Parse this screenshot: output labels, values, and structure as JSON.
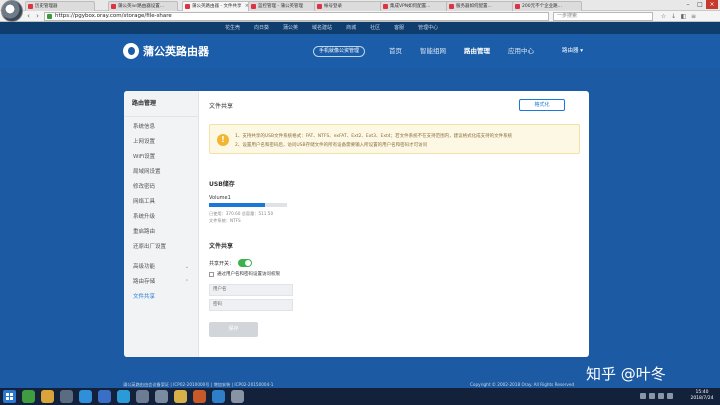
{
  "browser": {
    "tabs": [
      {
        "label": "历史管理器"
      },
      {
        "label": "蒲公英ivr路由器设置..."
      },
      {
        "label": "蒲公英路由器 - 文件共享"
      },
      {
        "label": "蓝控管理 - 蒲公英管理"
      },
      {
        "label": "帐号登录"
      },
      {
        "label": "集成VPN如何配置..."
      },
      {
        "label": "服务器如何配置..."
      },
      {
        "label": "200元不个企业路..."
      }
    ],
    "url": "https://pgybox.oray.com/storage/file-share",
    "search_placeholder": "一步搜索"
  },
  "site_topstrip": {
    "links": [
      "花生壳",
      "向日葵",
      "蒲公英",
      "域名建站",
      "商城",
      "社区",
      "客服",
      "管理中心"
    ]
  },
  "header": {
    "brand": "蒲公英路由器",
    "mobile_button": "手机就像公资管理",
    "nav": [
      "首页",
      "智能组网",
      "路由管理",
      "应用中心"
    ],
    "active_nav": "路由管理",
    "router_dropdown": "路由器 ▾"
  },
  "sidebar": {
    "title": "路由管理",
    "items": [
      "系统信息",
      "上网设置",
      "WiFi设置",
      "局域网设置",
      "修改密码",
      "网络工具",
      "系统升级",
      "重启路由",
      "还原出厂设置"
    ],
    "groups": [
      {
        "label": "高级功能",
        "chev": "⌄"
      },
      {
        "label": "路由存储",
        "chev": "⌃"
      }
    ],
    "active_item": "文件共享"
  },
  "main": {
    "title": "文件共享",
    "format_button": "格式化",
    "notice": {
      "line1": "1、支持共享的USB文件系统格式：FAT、NTFS、exFAT、Ext2、Ext3、Ext4；若文件系统不在支持范围内，建议格式化成支持的文件系统",
      "line2": "2、设置用户名和密码后，访问USB存储文件的所有设备需要输入所设置的用户名和密码才可访问"
    },
    "usb_title": "USB储存",
    "volume_name": "Volume1",
    "usage_fraction": 0.72,
    "usage_text": "已使用：370.60  总容量：511.50",
    "fs_text": "文件系统：NTFS",
    "share_title": "文件共享",
    "share_toggle_label": "共享开关：",
    "share_enabled": true,
    "auth_checkbox_label": "通过用户名和密码设置访问权限",
    "username_placeholder": "用户名",
    "password_placeholder": "密码",
    "save_button": "保存"
  },
  "footer": {
    "left": "蒲公英路由由会议备案证 | ICP02-2010000号 | 增加安装 | ICP02-20150004-1",
    "right": "Copyright © 2002-2018 Oray. All Rights Reserved"
  },
  "watermark": "知乎 @叶冬",
  "taskbar": {
    "time": "15:40",
    "date": "2018/7/24"
  }
}
